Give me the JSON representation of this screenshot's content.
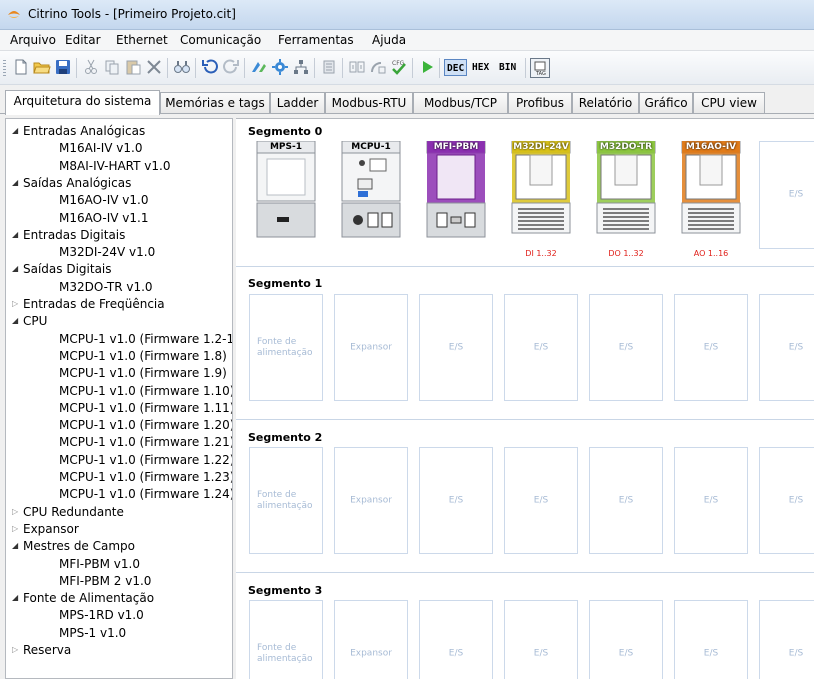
{
  "window": {
    "title": "Citrino Tools - [Primeiro Projeto.cit]"
  },
  "menu": [
    "Arquivo",
    "Editar",
    "Ethernet",
    "Comunicação",
    "Ferramentas",
    "Ajuda"
  ],
  "toolbar": {
    "dec": "DEC",
    "hex": "HEX",
    "bin": "BIN",
    "tag": "TAG"
  },
  "tabs": [
    "Arquitetura do sistema",
    "Memórias e tags",
    "Ladder",
    "Modbus-RTU",
    "Modbus/TCP",
    "Profibus",
    "Relatório",
    "Gráfico",
    "CPU view"
  ],
  "tree": [
    {
      "label": "Entradas Analógicas",
      "level": 0,
      "state": "expanded"
    },
    {
      "label": "M16AI-IV v1.0",
      "level": 1
    },
    {
      "label": "M8AI-IV-HART v1.0",
      "level": 1
    },
    {
      "label": "Saídas Analógicas",
      "level": 0,
      "state": "expanded"
    },
    {
      "label": "M16AO-IV v1.0",
      "level": 1
    },
    {
      "label": "M16AO-IV v1.1",
      "level": 1
    },
    {
      "label": "Entradas Digitais",
      "level": 0,
      "state": "expanded"
    },
    {
      "label": "M32DI-24V v1.0",
      "level": 1
    },
    {
      "label": "Saídas Digitais",
      "level": 0,
      "state": "expanded"
    },
    {
      "label": "M32DO-TR v1.0",
      "level": 1
    },
    {
      "label": "Entradas de Freqüência",
      "level": 0,
      "state": "collapsed"
    },
    {
      "label": "CPU",
      "level": 0,
      "state": "expanded"
    },
    {
      "label": "MCPU-1 v1.0 (Firmware 1.2-1.",
      "level": 1
    },
    {
      "label": "MCPU-1 v1.0 (Firmware 1.8)",
      "level": 1
    },
    {
      "label": "MCPU-1 v1.0 (Firmware 1.9)",
      "level": 1
    },
    {
      "label": "MCPU-1 v1.0 (Firmware 1.10)",
      "level": 1
    },
    {
      "label": "MCPU-1 v1.0 (Firmware 1.11)",
      "level": 1
    },
    {
      "label": "MCPU-1 v1.0 (Firmware 1.20)",
      "level": 1
    },
    {
      "label": "MCPU-1 v1.0 (Firmware 1.21)",
      "level": 1
    },
    {
      "label": "MCPU-1 v1.0 (Firmware 1.22)",
      "level": 1
    },
    {
      "label": "MCPU-1 v1.0 (Firmware 1.23)",
      "level": 1
    },
    {
      "label": "MCPU-1 v1.0 (Firmware 1.24)",
      "level": 1
    },
    {
      "label": "CPU Redundante",
      "level": 0,
      "state": "collapsed"
    },
    {
      "label": "Expansor",
      "level": 0,
      "state": "collapsed"
    },
    {
      "label": "Mestres de Campo",
      "level": 0,
      "state": "expanded"
    },
    {
      "label": "MFI-PBM v1.0",
      "level": 1
    },
    {
      "label": "MFI-PBM 2 v1.0",
      "level": 1
    },
    {
      "label": "Fonte de Alimentação",
      "level": 0,
      "state": "expanded"
    },
    {
      "label": "MPS-1RD v1.0",
      "level": 1
    },
    {
      "label": "MPS-1 v1.0",
      "level": 1
    },
    {
      "label": "Reserva",
      "level": 0,
      "state": "collapsed"
    }
  ],
  "segments": [
    {
      "title": "Segmento 0",
      "modules": [
        {
          "name": "MPS-1",
          "range": "",
          "color": "#8c9299"
        },
        {
          "name": "MCPU-1",
          "range": "",
          "color": "#8c9299"
        },
        {
          "name": "MFI-PBM",
          "range": "",
          "color": "#8b2fb0"
        },
        {
          "name": "M32DI-24V",
          "range": "DI 1..32",
          "color": "#d8c11a"
        },
        {
          "name": "M32DO-TR",
          "range": "DO 1..32",
          "color": "#8cc63f"
        },
        {
          "name": "M16AO-IV",
          "range": "AO 1..16",
          "color": "#e07b1a"
        }
      ],
      "empty_slots": [
        "E/S"
      ]
    },
    {
      "title": "Segmento 1",
      "slots": [
        "Fonte de alimentação",
        "Expansor",
        "E/S",
        "E/S",
        "E/S",
        "E/S",
        "E/S"
      ]
    },
    {
      "title": "Segmento 2",
      "slots": [
        "Fonte de alimentação",
        "Expansor",
        "E/S",
        "E/S",
        "E/S",
        "E/S",
        "E/S"
      ]
    },
    {
      "title": "Segmento 3",
      "slots": [
        "Fonte de alimentação",
        "Expansor",
        "E/S",
        "E/S",
        "E/S",
        "E/S",
        "E/S"
      ]
    }
  ]
}
